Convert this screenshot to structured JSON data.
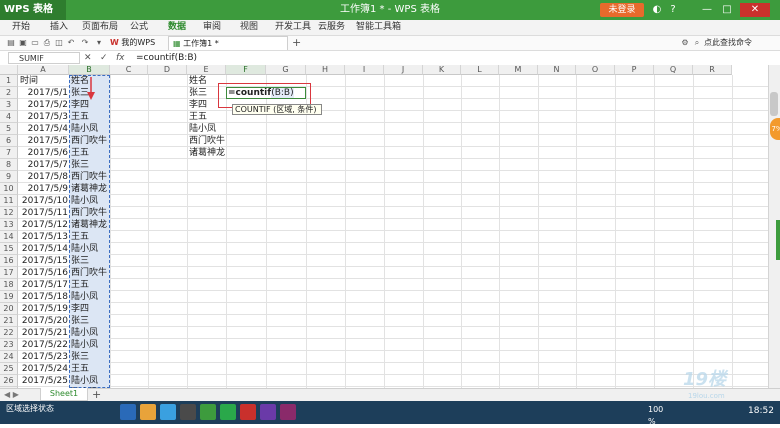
{
  "app": {
    "menu_label": "WPS 表格",
    "title": "工作簿1 * - WPS 表格",
    "login_label": "未登录"
  },
  "menu": [
    "开始",
    "插入",
    "页面布局",
    "公式",
    "数据",
    "审阅",
    "视图",
    "开发工具",
    "云服务",
    "智能工具箱"
  ],
  "doc_tabs": {
    "my_wps": "我的WPS",
    "workbook": "工作簿1 *",
    "new_tab": "+"
  },
  "search_cmd": "点此查找命令",
  "formula_bar": {
    "name_box": "SUMIF",
    "fx": "fx",
    "formula": "=countif(B:B)"
  },
  "columns": [
    "A",
    "B",
    "C",
    "D",
    "E",
    "F",
    "G",
    "H",
    "I",
    "J",
    "K",
    "L",
    "M",
    "N",
    "O",
    "P",
    "Q",
    "R"
  ],
  "rows": [
    {
      "n": "1",
      "a": "时间",
      "b": "姓名"
    },
    {
      "n": "2",
      "a": "2017/5/1",
      "b": "张三"
    },
    {
      "n": "3",
      "a": "2017/5/2",
      "b": "李四"
    },
    {
      "n": "4",
      "a": "2017/5/3",
      "b": "王五"
    },
    {
      "n": "5",
      "a": "2017/5/4",
      "b": "陆小凤"
    },
    {
      "n": "6",
      "a": "2017/5/5",
      "b": "西门吹牛"
    },
    {
      "n": "7",
      "a": "2017/5/6",
      "b": "王五"
    },
    {
      "n": "8",
      "a": "2017/5/7",
      "b": "张三"
    },
    {
      "n": "9",
      "a": "2017/5/8",
      "b": "西门吹牛"
    },
    {
      "n": "10",
      "a": "2017/5/9",
      "b": "诸葛神龙"
    },
    {
      "n": "11",
      "a": "2017/5/10",
      "b": "陆小凤"
    },
    {
      "n": "12",
      "a": "2017/5/11",
      "b": "西门吹牛"
    },
    {
      "n": "13",
      "a": "2017/5/12",
      "b": "诸葛神龙"
    },
    {
      "n": "14",
      "a": "2017/5/13",
      "b": "王五"
    },
    {
      "n": "15",
      "a": "2017/5/14",
      "b": "陆小凤"
    },
    {
      "n": "16",
      "a": "2017/5/15",
      "b": "张三"
    },
    {
      "n": "17",
      "a": "2017/5/16",
      "b": "西门吹牛"
    },
    {
      "n": "18",
      "a": "2017/5/17",
      "b": "王五"
    },
    {
      "n": "19",
      "a": "2017/5/18",
      "b": "陆小凤"
    },
    {
      "n": "20",
      "a": "2017/5/19",
      "b": "李四"
    },
    {
      "n": "21",
      "a": "2017/5/20",
      "b": "张三"
    },
    {
      "n": "22",
      "a": "2017/5/21",
      "b": "陆小凤"
    },
    {
      "n": "23",
      "a": "2017/5/22",
      "b": "陆小凤"
    },
    {
      "n": "24",
      "a": "2017/5/23",
      "b": "张三"
    },
    {
      "n": "25",
      "a": "2017/5/24",
      "b": "王五"
    },
    {
      "n": "26",
      "a": "2017/5/25",
      "b": "陆小凤"
    },
    {
      "n": "27",
      "a": "2017/5/26",
      "b": "陆小凤"
    }
  ],
  "column_e": [
    "姓名",
    "张三",
    "李四",
    "王五",
    "陆小凤",
    "西门吹牛",
    "诸葛神龙"
  ],
  "active_cell": {
    "formula_prefix": "=countif",
    "args": "(B:B)"
  },
  "tooltip": "COUNTIF (区域, 条件)",
  "sheet_tab": "Sheet1",
  "add_sheet": "+",
  "status": {
    "text": "区域选择状态",
    "zoom": "100 %",
    "clock": "18:52"
  },
  "watermark": {
    "logo": "19楼",
    "url": "19lou.com"
  },
  "badge": "7%",
  "colors": {
    "accent": "#3d9b3d",
    "login": "#e86a2c",
    "selection": "#dce6f4",
    "highlight_box": "#d9363e"
  }
}
